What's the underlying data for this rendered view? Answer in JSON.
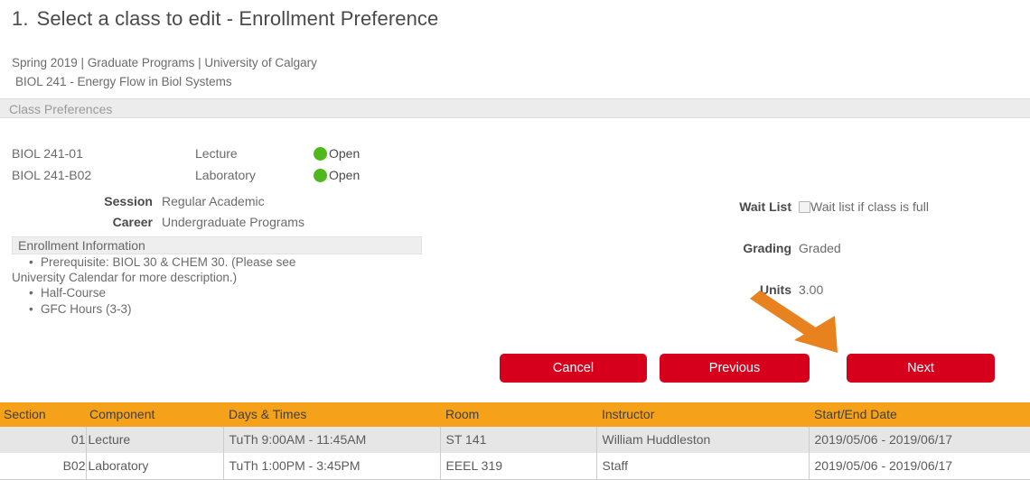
{
  "page": {
    "step_number": "1.",
    "title": "Select a class to edit - Enrollment Preference",
    "breadcrumb": "Spring 2019 | Graduate Programs | University of Calgary",
    "course_line": "BIOL  241 - Energy Flow in Biol Systems"
  },
  "sections": {
    "class_preferences_header": "Class Preferences",
    "enrollment_information_header": "Enrollment Information"
  },
  "class_rows": [
    {
      "code": "BIOL  241-01",
      "component": "Lecture",
      "status": "Open",
      "status_color": "#4fb81c"
    },
    {
      "code": "BIOL  241-B02",
      "component": "Laboratory",
      "status": "Open",
      "status_color": "#4fb81c"
    }
  ],
  "left_fields": [
    {
      "label": "Session",
      "value": "Regular Academic"
    },
    {
      "label": "Career",
      "value": "Undergraduate Programs"
    }
  ],
  "enrollment_information": [
    {
      "line1": "Prerequisite: BIOL 30 & CHEM 30. (Please see",
      "line2": "University Calendar for more description.)"
    },
    {
      "line1": "Half-Course",
      "line2": ""
    },
    {
      "line1": "GFC Hours (3-3)",
      "line2": ""
    }
  ],
  "right_fields": {
    "wait_list": {
      "label": "Wait List",
      "checkbox_label": "Wait list if class is full",
      "checked": false
    },
    "grading": {
      "label": "Grading",
      "value": "Graded"
    },
    "units": {
      "label": "Units",
      "value": "3.00"
    }
  },
  "buttons": {
    "cancel": "Cancel",
    "previous": "Previous",
    "next": "Next",
    "color": "#d6001c"
  },
  "annotation": {
    "arrow_icon": "arrow-pointing-down-right",
    "color": "#e8821e",
    "points_to": "Next"
  },
  "schedule_table": {
    "header_color": "#f5a21a",
    "columns": [
      "Section",
      "Component",
      "Days & Times",
      "Room",
      "Instructor",
      "Start/End Date"
    ],
    "rows": [
      {
        "section": "01",
        "component": "Lecture",
        "days_times": "TuTh 9:00AM - 11:45AM",
        "room": "ST 141",
        "instructor": "William Huddleston",
        "start_end_date": "2019/05/06 - 2019/06/17"
      },
      {
        "section": "B02",
        "component": "Laboratory",
        "days_times": "TuTh 1:00PM - 3:45PM",
        "room": "EEEL 319",
        "instructor": "Staff",
        "start_end_date": "2019/05/06 - 2019/06/17"
      }
    ]
  }
}
